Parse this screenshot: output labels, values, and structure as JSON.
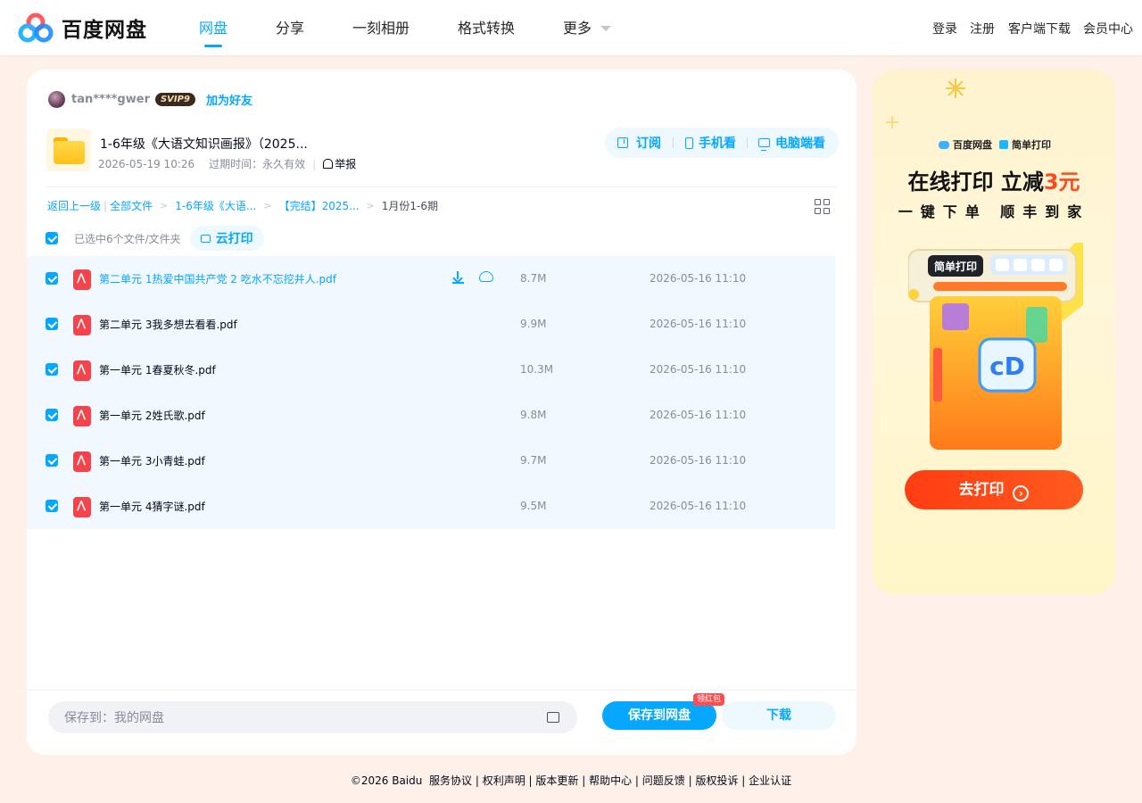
{
  "header": {
    "brand": "百度网盘",
    "nav": [
      "网盘",
      "分享",
      "一刻相册",
      "格式转换",
      "更多"
    ],
    "right_links": [
      "登录",
      "注册",
      "客户端下载",
      "会员中心"
    ]
  },
  "share": {
    "user_name": "tan****gwer",
    "vip_badge": "SVIP9",
    "add_friend": "加为好友",
    "title": "1-6年级《大语文知识画报》（2025...",
    "created": "2026-05-19 10:26",
    "expire": "过期时间：永久有效",
    "report": "举报",
    "actions": {
      "subscribe": "订阅",
      "mobile": "手机看",
      "desktop": "电脑端看"
    }
  },
  "breadcrumb": {
    "back": "返回上一级",
    "all": "全部文件",
    "c1": "1-6年级《大语...",
    "c2": "【完结】2025...",
    "current": "1月份1-6期"
  },
  "selection": {
    "count_text": "已选中6个文件/文件夹",
    "cloud_print": "云打印"
  },
  "files": [
    {
      "name": "第二单元 1热爱中国共产党 2 吃水不忘挖井人.pdf",
      "size": "8.7M",
      "time": "2026-05-16 11:10"
    },
    {
      "name": "第二单元 3我多想去看看.pdf",
      "size": "9.9M",
      "time": "2026-05-16 11:10"
    },
    {
      "name": "第一单元 1春夏秋冬.pdf",
      "size": "10.3M",
      "time": "2026-05-16 11:10"
    },
    {
      "name": "第一单元 2姓氏歌.pdf",
      "size": "9.8M",
      "time": "2026-05-16 11:10"
    },
    {
      "name": "第一单元 3小青蛙.pdf",
      "size": "9.7M",
      "time": "2026-05-16 11:10"
    },
    {
      "name": "第一单元 4猜字谜.pdf",
      "size": "9.5M",
      "time": "2026-05-16 11:10"
    }
  ],
  "footer_bar": {
    "save_path": "保存到：我的网盘",
    "save_button": "保存到网盘",
    "badge": "领红包",
    "download_button": "下载"
  },
  "ad": {
    "brand_left": "百度网盘",
    "brand_right": "简单打印",
    "headline_pre": "在线打印 立减",
    "headline_hl": "3元",
    "subline": "一键下单 顺丰到家",
    "illus_label": "简单打印",
    "cta": "去打印"
  },
  "page_footer": {
    "copyright": "©2026 Baidu",
    "links": [
      "服务协议",
      "权利声明",
      "版本更新",
      "帮助中心",
      "问题反馈",
      "版权投诉",
      "企业认证"
    ]
  },
  "colors": {
    "accent": "#06a7ff",
    "background": "#fdf1ea",
    "ad_cta": "#ff3c12"
  }
}
